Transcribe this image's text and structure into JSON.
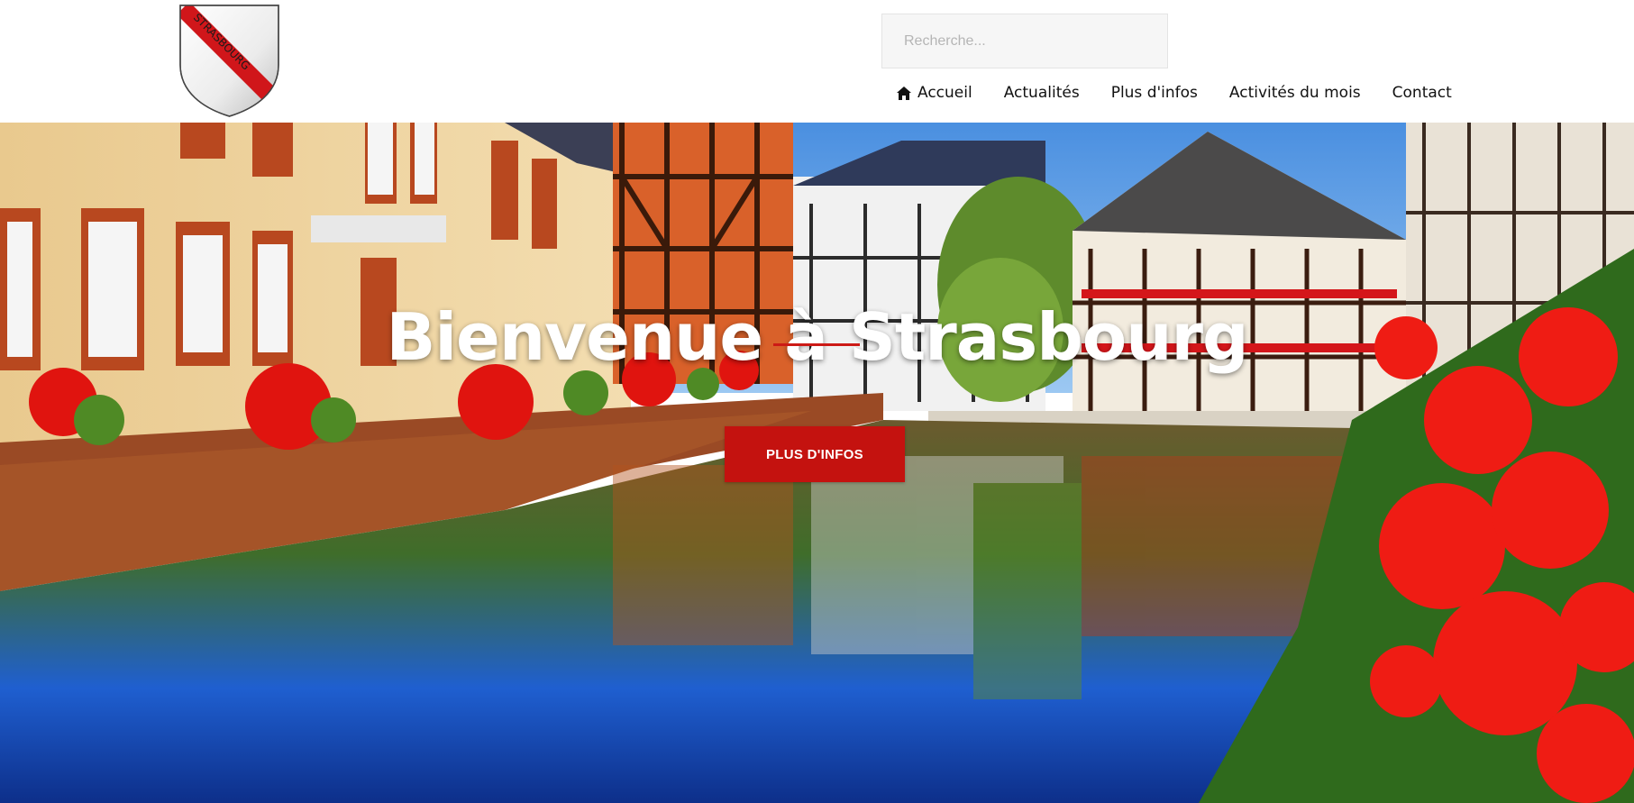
{
  "header": {
    "logo_text": "STRASBOURG",
    "search": {
      "placeholder": "Recherche...",
      "value": ""
    },
    "nav": [
      {
        "label": "Accueil",
        "icon": "home-icon"
      },
      {
        "label": "Actualités"
      },
      {
        "label": "Plus d'infos"
      },
      {
        "label": "Activités du mois"
      },
      {
        "label": "Contact"
      }
    ]
  },
  "hero": {
    "title": "Bienvenue à Strasbourg",
    "button_label": "PLUS D'INFOS"
  },
  "colors": {
    "accent": "#c4120f",
    "nav_text": "#111111",
    "search_bg": "#f6f6f6"
  }
}
